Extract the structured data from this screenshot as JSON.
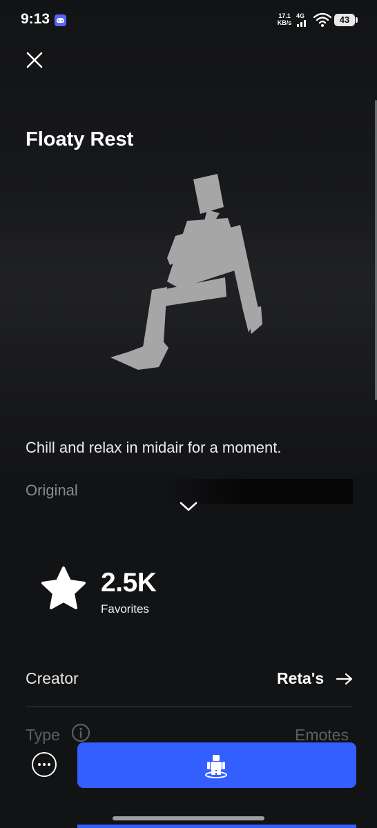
{
  "status_bar": {
    "time": "9:13",
    "net_speed_value": "17.1",
    "net_speed_unit": "KB/s",
    "signal_label": "4G",
    "battery": "43"
  },
  "item": {
    "title": "Floaty Rest",
    "description": "Chill and relax in midair for a moment.",
    "category": "Original"
  },
  "stats": {
    "favorites_count": "2.5K",
    "favorites_label": "Favorites"
  },
  "details": {
    "creator_label": "Creator",
    "creator_name": "Reta's",
    "type_label": "Type",
    "type_value": "Emotes"
  },
  "icons": {
    "close": "close-icon",
    "expand": "chevron-down-icon",
    "favorites": "star-icon",
    "creator_link": "arrow-right-icon",
    "info": "info-icon",
    "more": "more-icon",
    "try_on": "avatar-icon"
  },
  "colors": {
    "background": "#121315",
    "primary_button": "#335fff",
    "figure": "#a6a6a6",
    "text_primary": "#ffffff",
    "text_muted": "#5d5e62"
  }
}
